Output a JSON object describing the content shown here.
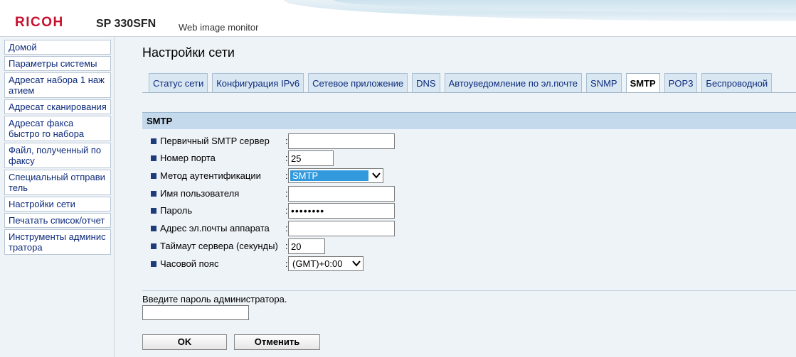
{
  "header": {
    "brand": "RICOH",
    "model": "SP 330SFN",
    "subtitle": "Web image monitor"
  },
  "sidebar": {
    "items": [
      {
        "label": "Домой"
      },
      {
        "label": "Параметры системы"
      },
      {
        "label": "Адресат набора 1 наж атием"
      },
      {
        "label": "Адресат сканирования"
      },
      {
        "label": "Адресат факса быстро го набора"
      },
      {
        "label": "Файл, полученный по факсу"
      },
      {
        "label": "Специальный отправи тель"
      },
      {
        "label": "Настройки сети"
      },
      {
        "label": "Печатать список/отчет"
      },
      {
        "label": "Инструменты админис тратора"
      }
    ]
  },
  "main": {
    "title": "Настройки сети",
    "tabs": [
      {
        "label": "Статус сети",
        "active": false
      },
      {
        "label": "Конфигурация IPv6",
        "active": false
      },
      {
        "label": "Сетевое приложение",
        "active": false
      },
      {
        "label": "DNS",
        "active": false
      },
      {
        "label": "Автоуведомление по эл.почте",
        "active": false
      },
      {
        "label": "SNMP",
        "active": false
      },
      {
        "label": "SMTP",
        "active": true
      },
      {
        "label": "POP3",
        "active": false
      },
      {
        "label": "Беспроводной",
        "active": false
      }
    ],
    "section_title": "SMTP",
    "fields": {
      "primary_server": {
        "label": "Первичный SMTP сервер",
        "value": ""
      },
      "port": {
        "label": "Номер порта",
        "value": "25"
      },
      "auth_method": {
        "label": "Метод аутентификации",
        "value": "SMTP"
      },
      "username": {
        "label": "Имя пользователя",
        "value": ""
      },
      "password": {
        "label": "Пароль",
        "value": "••••••••"
      },
      "device_email": {
        "label": "Адрес эл.почты аппарата",
        "value": ""
      },
      "server_timeout": {
        "label": "Таймаут сервера (секунды)",
        "value": "20"
      },
      "timezone": {
        "label": "Часовой пояс",
        "value": "(GMT)+0:00"
      }
    },
    "colon": ":",
    "admin_password_label": "Введите пароль администратора.",
    "admin_password_value": "",
    "ok_label": "OK",
    "cancel_label": "Отменить"
  },
  "colors": {
    "brand_red": "#c8102e",
    "nav_text": "#0c2a7a",
    "section_bar": "#c5d9ec",
    "select_highlight": "#3399dd"
  }
}
